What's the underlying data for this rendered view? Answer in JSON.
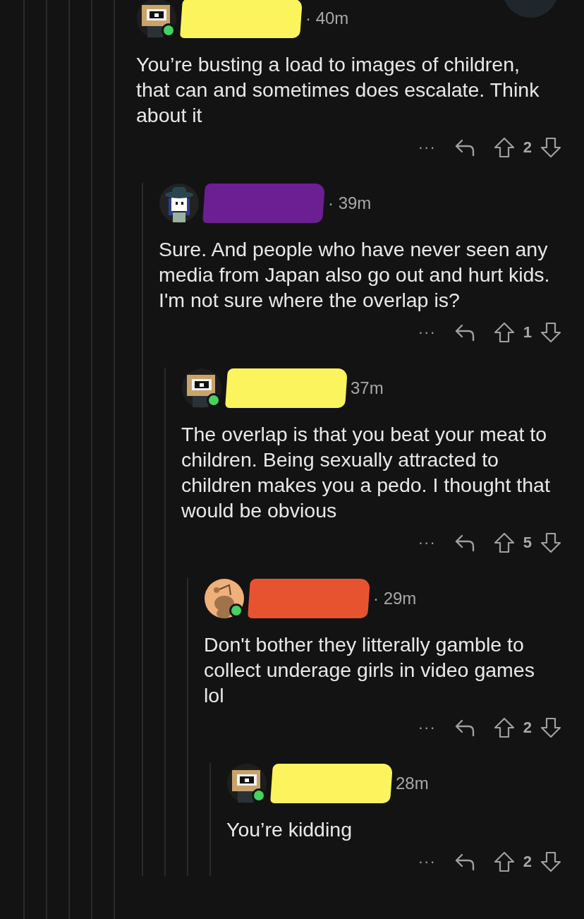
{
  "floating_button": {
    "visible": true
  },
  "thread": [
    {
      "avatar": {
        "kind": "box",
        "online": true
      },
      "author": {
        "kind": "redaction",
        "color": "#fbf45c"
      },
      "time": "· 40m",
      "body": "You’re busting a load to images of children, that can and sometimes does escalate. Think about it",
      "more": "···",
      "votes": "2",
      "children": [
        {
          "avatar": {
            "kind": "hat",
            "online": false
          },
          "author": {
            "kind": "redaction",
            "color": "#6b1f92"
          },
          "time": "· 39m",
          "body": "Sure. And people who have never seen any media from Japan also go out and hurt kids. I'm not sure where the overlap is?",
          "more": "···",
          "votes": "1",
          "children": [
            {
              "avatar": {
                "kind": "box",
                "online": true
              },
              "author": {
                "kind": "redaction",
                "color": "#fbf45c"
              },
              "time": "37m",
              "body": "The overlap is that you beat your meat to children. Being sexually attracted to children makes you a pedo. I thought that would be obvious",
              "more": "···",
              "votes": "5",
              "children": [
                {
                  "avatar": {
                    "kind": "snoo",
                    "online": true
                  },
                  "author": {
                    "kind": "redaction",
                    "color": "#e8532f"
                  },
                  "time": "· 29m",
                  "body": "Don't bother they litterally gamble to collect underage girls in video games lol",
                  "more": "···",
                  "votes": "2",
                  "children": [
                    {
                      "avatar": {
                        "kind": "box",
                        "online": true
                      },
                      "author": {
                        "kind": "redaction",
                        "color": "#fbf45c"
                      },
                      "time": "28m",
                      "body": "You’re kidding",
                      "more": "···",
                      "votes": "2"
                    }
                  ]
                }
              ]
            }
          ]
        }
      ]
    }
  ]
}
